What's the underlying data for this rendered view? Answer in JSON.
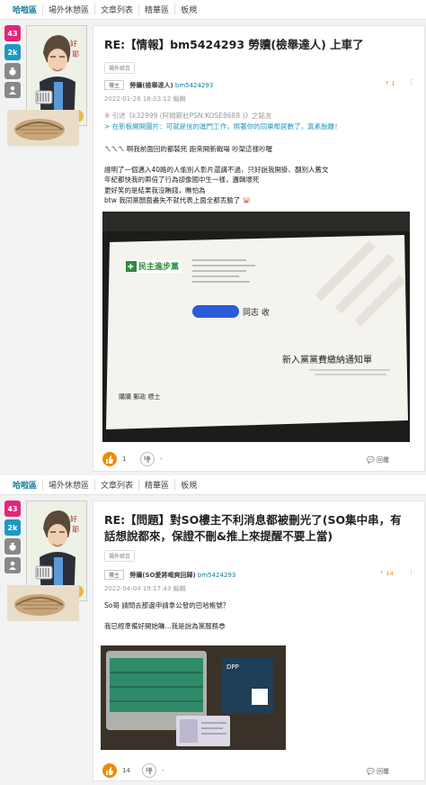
{
  "nav": {
    "tabs": [
      "哈啦區",
      "場外休憩區",
      "文章列表",
      "精華區",
      "板規"
    ]
  },
  "posts": [
    {
      "level": "43",
      "gp": "2k",
      "title": "RE:【情報】bm5424293 勞贖(檢舉達人) 上車了",
      "tag": "場外綜合",
      "floor": "樓主",
      "author": "勞贖(檢舉達人)",
      "uid": "bm5424293",
      "gp_count": "1",
      "time": "2022-01-26 18:03:12 編輯",
      "ref1": "※ 引述《k32999 (阿姆斯壯PSN:KOSE8688 )》之銘言",
      "ref2": "> 在新板開開圖片：可就是信的進門工作，照著你的同樂鄰居數了，真素脫離！",
      "lines": [
        "ㄟㄟㄟ 啊我前面回的都裝死 跑來開新戰場 吵架這樣吵喔",
        "",
        "證明了一個邁入40路的人偷別人影片還講不過，只好說我開掛、翻別人舊文",
        "年紀都快我的兩倍了行為卻像國中生一樣，邏輯壞死",
        "更好笑的是結果我沒賄錢，瞧怕為",
        "btw 我同黨顏面盡失不就代表上面全都丟臉了"
      ],
      "envelope_party": "民主進步黨",
      "envelope_recipient": "同志 收",
      "envelope_notice": "新入黨黨費繳納通知單",
      "envelope_footer": "購購 郵政 標士",
      "likes": "1",
      "dislikes": "-",
      "reply": "回覆"
    },
    {
      "level": "43",
      "gp": "2k",
      "title": "RE:【問題】對SO樓主不利消息都被刪光了(SO集中串，有話想說都來，保證不刪&推上來提醒不要上當)",
      "tag": "場外綜合",
      "floor": "樓主",
      "author": "勞贖(SO愛將嘅爽回歸)",
      "uid": "bm5424293",
      "gp_count": "14",
      "time": "2022-04-04 19:17:43 編輯",
      "lines": [
        "So哥 請問去那邊申請拿公發的巴哈帳號？",
        "",
        "我已經準備好開始賺...我是說為黨服務😎"
      ],
      "box_label": "DPP",
      "likes": "14",
      "dislikes": "-",
      "reply": "回覆"
    }
  ]
}
